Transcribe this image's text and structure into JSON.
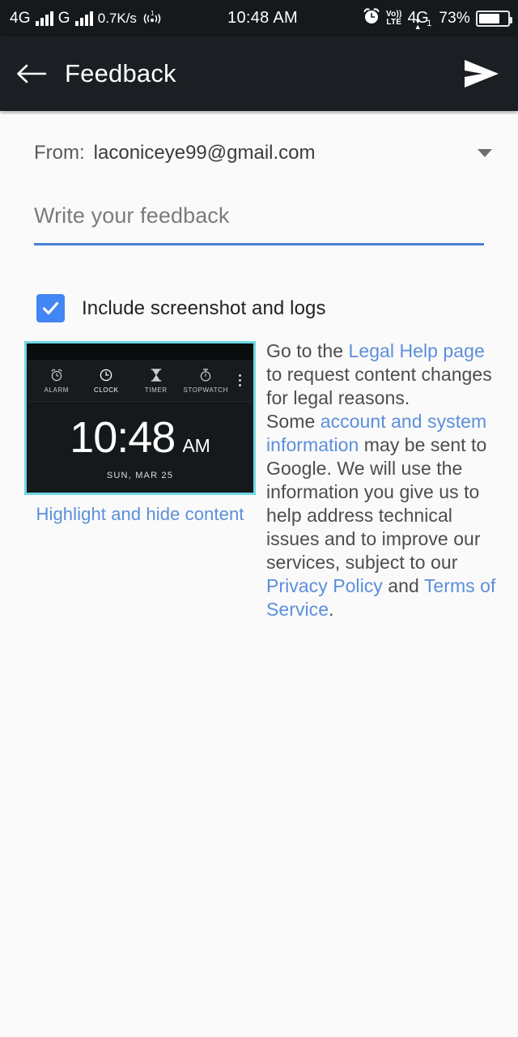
{
  "statusbar": {
    "network_1": "4G",
    "network_2": "G",
    "data_rate": "0.7K/s",
    "hotspot_badge": "1",
    "clock": "10:48 AM",
    "alarm_icon": "alarm-clock-icon",
    "volte_top": "Vo))",
    "volte_bottom": "LTE",
    "sim_network": "4G",
    "sim_index": "1",
    "battery_percent": "73%",
    "battery_level": 73
  },
  "toolbar": {
    "back_label": "back-arrow",
    "title": "Feedback",
    "send_label": "send"
  },
  "form": {
    "from_label": "From:",
    "from_email": "laconiceye99@gmail.com",
    "from_caret": "chevron-down-icon",
    "feedback_placeholder": "Write your feedback",
    "feedback_value": "",
    "checkbox_label": "Include screenshot and logs",
    "checkbox_checked": true,
    "accent_blue": "#4285f4",
    "underline_blue": "#4a7fd4",
    "link_blue": "#5c8fdc"
  },
  "screenshot_preview": {
    "border_color": "#6ed8e3",
    "tabs": [
      {
        "label": "ALARM",
        "icon": "alarm-icon"
      },
      {
        "label": "CLOCK",
        "icon": "clock-icon"
      },
      {
        "label": "TIMER",
        "icon": "hourglass-icon"
      },
      {
        "label": "STOPWATCH",
        "icon": "stopwatch-icon"
      }
    ],
    "active_tab": "CLOCK",
    "overflow_icon": "more-vert-icon",
    "time": "10:48",
    "ampm": "AM",
    "date": "SUN, MAR 25",
    "highlight_link": "Highlight and hide content"
  },
  "legal": {
    "part_1": "Go to the ",
    "link_1": "Legal Help page",
    "part_2": " to request content changes for legal reasons.",
    "part_3": "Some ",
    "link_2": "account and system information",
    "part_4": " may be sent to Google. We will use the information you give us to help address technical issues and to improve our services, subject to our ",
    "link_3": "Privacy Policy",
    "part_5": " and ",
    "link_4": "Terms of Service",
    "part_6": "."
  }
}
